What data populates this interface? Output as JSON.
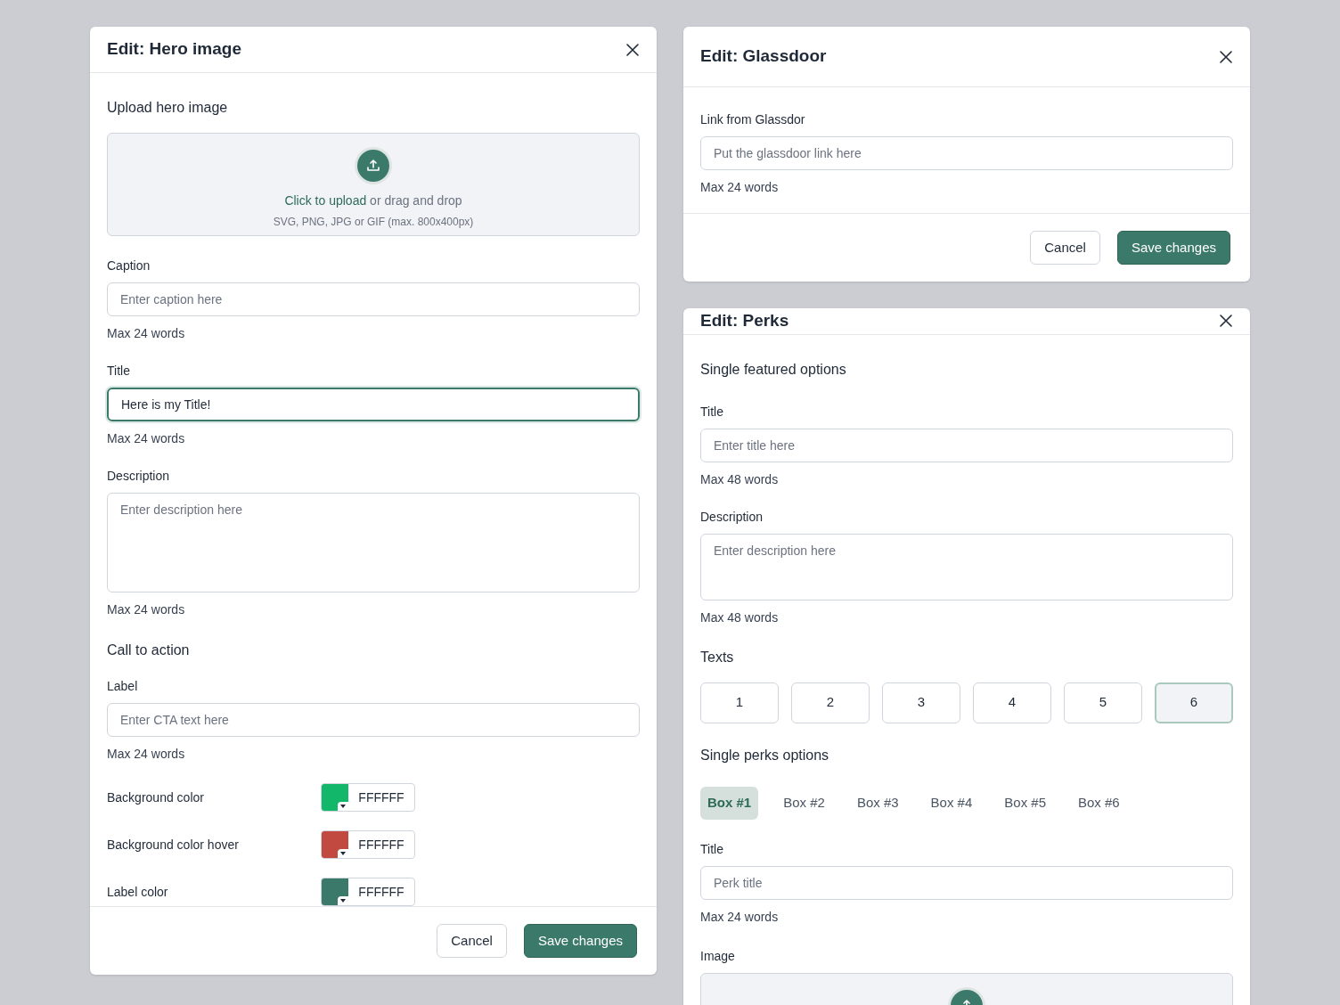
{
  "hero_dialog": {
    "title": "Edit: Hero image",
    "upload": {
      "heading": "Upload hero image",
      "link": "Click to upload",
      "rest": "or drag and drop",
      "hint": "SVG, PNG, JPG or GIF (max. 800x400px)"
    },
    "fields": [
      {
        "kind": "input",
        "label": "Caption",
        "placeholder": "Enter caption here",
        "help": "Max 24 words",
        "focused": false
      },
      {
        "kind": "input",
        "label": "Title",
        "value": "Here is my Title!",
        "help": "Max 24 words",
        "focused": true
      },
      {
        "kind": "textarea",
        "label": "Description",
        "placeholder": "Enter description here",
        "help": "Max 24 words",
        "focused": false
      }
    ],
    "cta": {
      "heading": "Call to action",
      "fields": [
        {
          "kind": "input",
          "label": "Label",
          "placeholder": "Enter CTA text here",
          "help": "Max 24 words",
          "focused": false
        }
      ],
      "colors": [
        {
          "label": "Background color",
          "color": "#12b76a",
          "value": "FFFFFF"
        },
        {
          "label": "Background color hover",
          "color": "#c2493f",
          "value": "FFFFFF"
        },
        {
          "label": "Label color",
          "color": "#3b7a6b",
          "value": "FFFFFF"
        }
      ]
    },
    "buttons": {
      "cancel": "Cancel",
      "save": "Save changes"
    }
  },
  "glassdoor_dialog": {
    "title": "Edit: Glassdoor",
    "fields": [
      {
        "kind": "input",
        "label": "Link from Glassdor",
        "placeholder": "Put the glassdoor link here",
        "help": "Max 24 words",
        "focused": false
      }
    ],
    "buttons": {
      "cancel": "Cancel",
      "save": "Save changes"
    }
  },
  "perks_dialog": {
    "title": "Edit: Perks",
    "heading": "Single featured options",
    "fields": [
      {
        "kind": "input",
        "label": "Title",
        "placeholder": "Enter title here",
        "help": "Max 48 words",
        "focused": false
      },
      {
        "kind": "textarea",
        "label": "Description",
        "placeholder": "Enter description here",
        "help": "Max 48 words",
        "focused": false
      }
    ],
    "texts": {
      "heading": "Texts",
      "tiles": [
        {
          "label": "1",
          "selected": false
        },
        {
          "label": "2",
          "selected": false
        },
        {
          "label": "3",
          "selected": false
        },
        {
          "label": "4",
          "selected": false
        },
        {
          "label": "5",
          "selected": false
        },
        {
          "label": "6",
          "selected": true
        }
      ]
    },
    "perks": {
      "heading": "Single perks options",
      "tabs": [
        {
          "label": "Box #1",
          "selected": true
        },
        {
          "label": "Box #2",
          "selected": false
        },
        {
          "label": "Box #3",
          "selected": false
        },
        {
          "label": "Box #4",
          "selected": false
        },
        {
          "label": "Box #5",
          "selected": false
        },
        {
          "label": "Box #6",
          "selected": false
        }
      ],
      "fields": [
        {
          "kind": "input",
          "label": "Title",
          "placeholder": "Perk title",
          "help": "Max 24 words",
          "focused": false
        }
      ],
      "image_label": "Image"
    }
  }
}
